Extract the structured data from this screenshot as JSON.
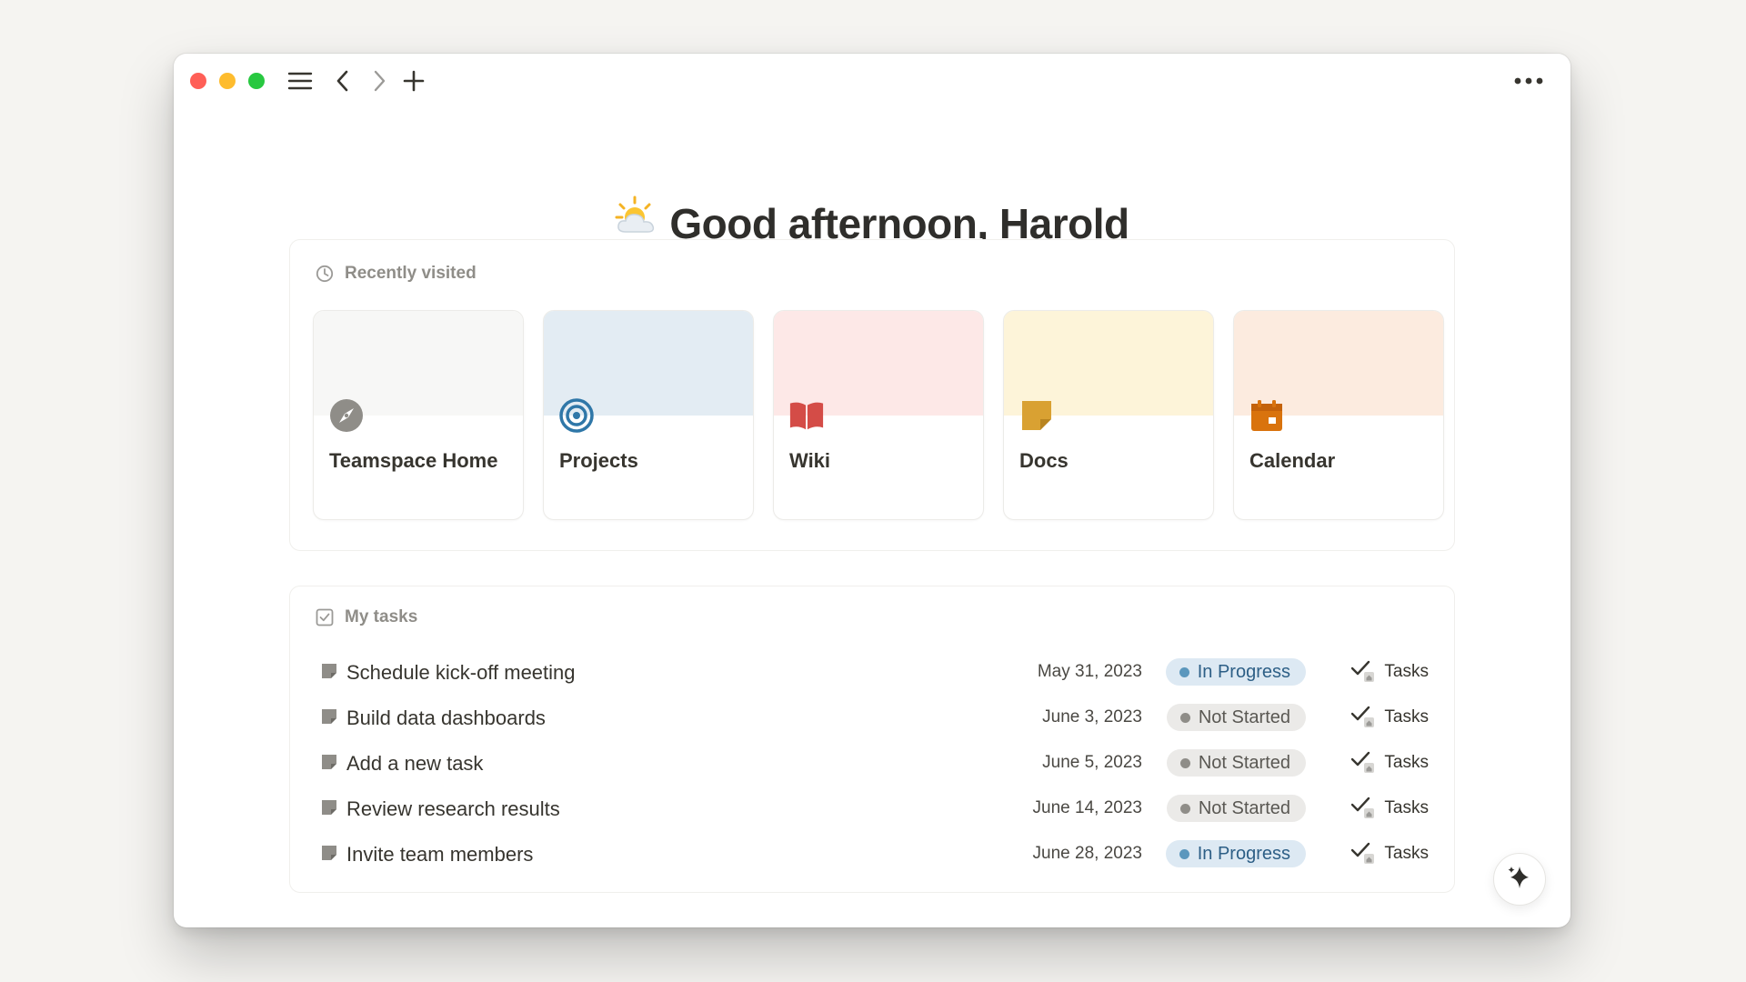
{
  "window": {
    "controls": [
      "close",
      "minimize",
      "zoom"
    ],
    "toolbar_icons": [
      "menu-icon",
      "back-icon",
      "forward-icon",
      "plus-icon",
      "more-icon"
    ]
  },
  "greeting": {
    "emoji": "sun-behind-cloud",
    "text": "Good afternoon, Harold"
  },
  "recently_visited": {
    "title": "Recently visited",
    "icon": "clock-icon",
    "cards": [
      {
        "label": "Teamspace Home",
        "icon": "compass-icon",
        "cover": "#f7f7f6",
        "icon_color": "#8f8d88"
      },
      {
        "label": "Projects",
        "icon": "target-icon",
        "cover": "#e3ecf3",
        "icon_color": "#2f77a8"
      },
      {
        "label": "Wiki",
        "icon": "book-icon",
        "cover": "#fde8e7",
        "icon_color": "#d44c47"
      },
      {
        "label": "Docs",
        "icon": "sticky-note-icon",
        "cover": "#fdf4d9",
        "icon_color": "#d9a132"
      },
      {
        "label": "Calendar",
        "icon": "calendar-icon",
        "cover": "#fcebdf",
        "icon_color": "#d9730d"
      }
    ]
  },
  "my_tasks": {
    "title": "My tasks",
    "icon": "checkbox-icon",
    "rows": [
      {
        "title": "Schedule kick-off meeting",
        "date": "May 31, 2023",
        "status": "In Progress",
        "status_kind": "inprogress",
        "database": "Tasks"
      },
      {
        "title": "Build data dashboards",
        "date": "June 3, 2023",
        "status": "Not Started",
        "status_kind": "notstarted",
        "database": "Tasks"
      },
      {
        "title": "Add a new task",
        "date": "June 5, 2023",
        "status": "Not Started",
        "status_kind": "notstarted",
        "database": "Tasks"
      },
      {
        "title": "Review research results",
        "date": "June 14, 2023",
        "status": "Not Started",
        "status_kind": "notstarted",
        "database": "Tasks"
      },
      {
        "title": "Invite team members",
        "date": "June 28, 2023",
        "status": "In Progress",
        "status_kind": "inprogress",
        "database": "Tasks"
      }
    ]
  },
  "colors": {
    "in_progress_bg": "#dde9f3",
    "in_progress_dot": "#5b97bd",
    "not_started_bg": "#ebeae8",
    "not_started_dot": "#8f8d88"
  }
}
